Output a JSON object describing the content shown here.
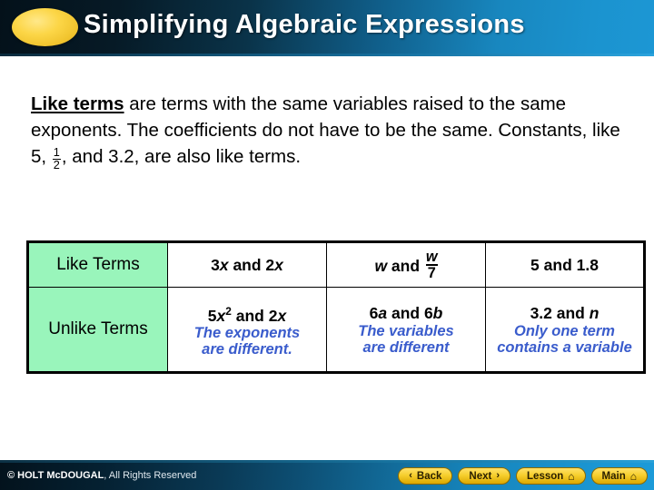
{
  "header": {
    "title": "Simplifying Algebraic Expressions",
    "bg_start": "#03121c",
    "bg_end": "#1c9ad8",
    "ellipse_color": "#f6cf2e"
  },
  "body": {
    "lead": "Like terms",
    "part1": " are terms with the same variables raised to the same exponents. The coefficients do not have to be the same. Constants, like 5, ",
    "fraction_numerator": "1",
    "fraction_denominator": "2",
    "part2": ", and 3.2, are also like terms."
  },
  "table": {
    "rows": [
      {
        "label": "Like Terms",
        "cells": [
          {
            "expr_a": "3",
            "expr_a_var": "x",
            "expr_and": " and ",
            "expr_b": "2",
            "expr_b_var": "x",
            "note": ""
          },
          {
            "expr_a": "",
            "expr_a_var": "w",
            "expr_and": " and ",
            "frac_num": "w",
            "frac_den": "7",
            "note": ""
          },
          {
            "expr_plain": "5 and 1.8",
            "note": ""
          }
        ]
      },
      {
        "label": "Unlike Terms",
        "cells": [
          {
            "expr_a": "5",
            "expr_a_var": "x",
            "expr_a_sup": "2",
            "expr_and": " and ",
            "expr_b": "2",
            "expr_b_var": "x",
            "note_line1": "The exponents",
            "note_line2": "are different."
          },
          {
            "expr_a": "6",
            "expr_a_var": "a",
            "expr_and": " and ",
            "expr_b": "6",
            "expr_b_var": "b",
            "note_line1": "The variables",
            "note_line2": "are different"
          },
          {
            "expr_a": "3.2",
            "expr_and": " and ",
            "expr_b_var": "n",
            "note_full": "Only one term contains a variable"
          }
        ]
      }
    ],
    "label_bg": "#99f5bb",
    "note_color": "#3a5ccc"
  },
  "footer": {
    "copyright_strong": "© HOLT McDOUGAL",
    "copyright_rest": ", All Rights Reserved",
    "buttons": [
      {
        "label": "Back",
        "glyph": "‹",
        "glyph_side": "left"
      },
      {
        "label": "Next",
        "glyph": "›",
        "glyph_side": "right"
      },
      {
        "label": "Lesson",
        "glyph": "⌂",
        "glyph_side": "right"
      },
      {
        "label": "Main",
        "glyph": "⌂",
        "glyph_side": "right"
      }
    ]
  }
}
